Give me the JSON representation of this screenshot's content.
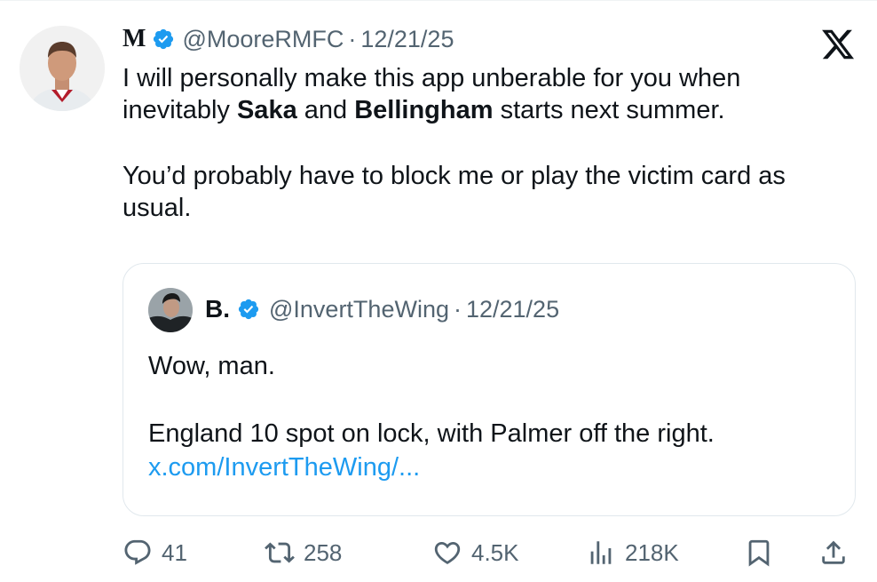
{
  "tweet": {
    "author_name": "M",
    "handle": "@MooreRMFC",
    "separator": "·",
    "date": "12/21/25",
    "text_lines": [
      [
        "I will personally make this app unberable for you when inevitably ",
        "Saka",
        " and ",
        "Bellingham",
        " starts next summer."
      ],
      [
        "You’d probably have to block me or play the victim card as usual."
      ]
    ]
  },
  "quoted_tweet": {
    "author_name": "B.",
    "handle": "@InvertTheWing",
    "separator": "·",
    "date": "12/21/25",
    "line1": "Wow, man.",
    "line2": "England 10 spot on lock, with Palmer off the right.",
    "link": "x.com/InvertTheWing/..."
  },
  "actions": {
    "replies": "41",
    "reposts": "258",
    "likes": "4.5K",
    "views": "218K"
  },
  "icons": {
    "brand": "x-logo-icon",
    "verified": "verified-badge-icon",
    "reply": "reply-icon",
    "repost": "repost-icon",
    "like": "heart-icon",
    "views": "views-icon",
    "bookmark": "bookmark-icon",
    "share": "share-icon"
  },
  "colors": {
    "accent": "#1d9bf0",
    "text": "#0f1419",
    "muted": "#536471",
    "border": "#e1e8ed"
  }
}
